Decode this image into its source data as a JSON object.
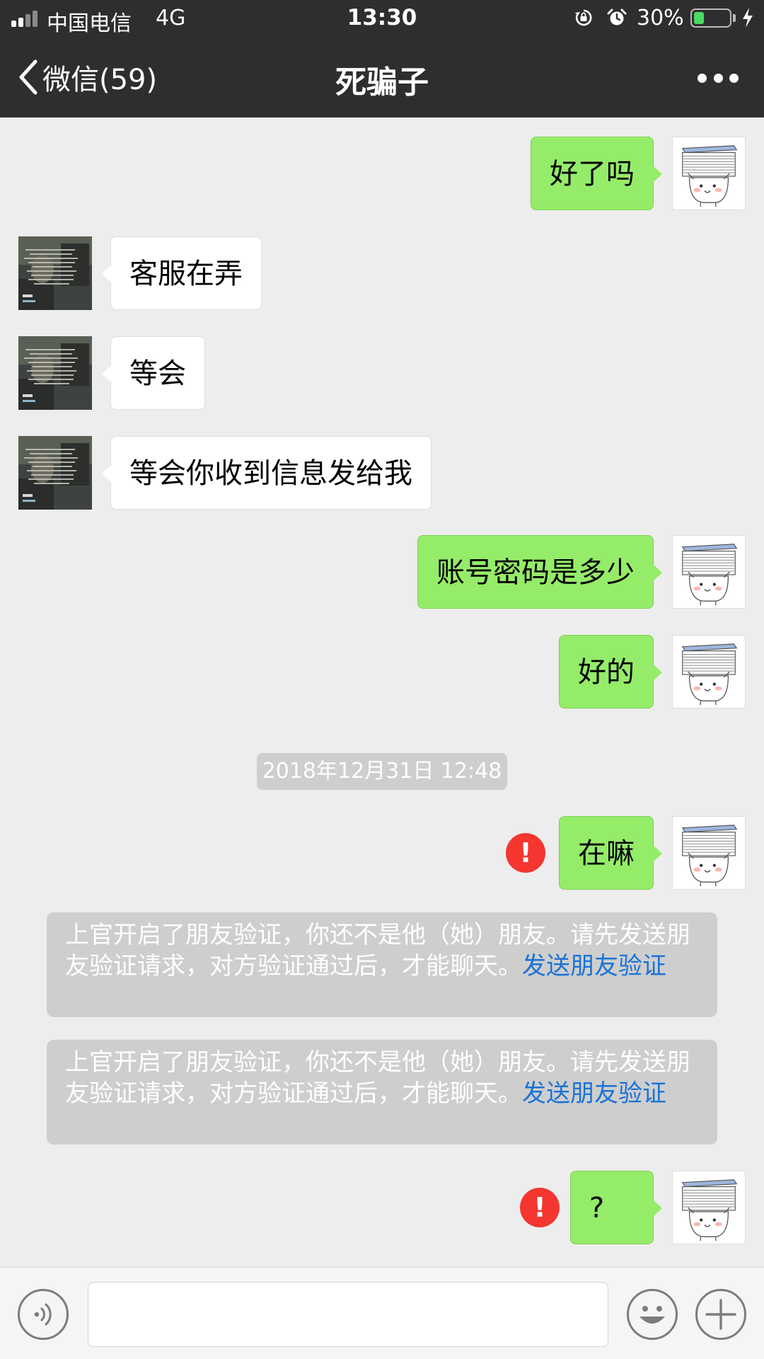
{
  "status_bar": {
    "carrier": "中国电信",
    "network": "4G",
    "time": "13:30",
    "battery_percent_label": "30%",
    "battery_level": 0.3,
    "battery_color": "#4cd964"
  },
  "nav": {
    "back_label": "微信(59)",
    "title": "死骗子",
    "more_icon": "ellipsis-icon"
  },
  "messages": [
    {
      "side": "right",
      "text": "好了吗",
      "failed": false
    },
    {
      "side": "left",
      "text": "客服在弄",
      "failed": false
    },
    {
      "side": "left",
      "text": "等会",
      "failed": false
    },
    {
      "side": "left",
      "text": "等会你收到信息发给我",
      "failed": false
    },
    {
      "side": "right",
      "text": "账号密码是多少",
      "failed": false
    },
    {
      "side": "right",
      "text": "好的",
      "failed": false
    },
    {
      "side": "right",
      "text": "在嘛",
      "failed": true
    },
    {
      "side": "right",
      "text": "?",
      "failed": true
    }
  ],
  "timestamp": "2018年12月31日 12:48",
  "system_notices": [
    {
      "text": "上官开启了朋友验证，你还不是他（她）朋友。请先发送朋友验证请求，对方验证通过后，才能聊天。",
      "link": "发送朋友验证"
    },
    {
      "text": "上官开启了朋友验证，你还不是他（她）朋友。请先发送朋友验证请求，对方验证通过后，才能聊天。",
      "link": "发送朋友验证"
    }
  ],
  "failed_icon_label": "!",
  "colors": {
    "header_bg": "#2e2e30",
    "chat_bg": "#ededed",
    "sent_bubble": "#95ec69",
    "received_bubble": "#ffffff",
    "notice_bg": "#cecece",
    "link": "#1a73d6",
    "error": "#f43530"
  },
  "input_bar": {
    "voice_icon": "voice-icon",
    "emoji_icon": "emoji-icon",
    "plus_icon": "plus-icon",
    "input_value": ""
  }
}
